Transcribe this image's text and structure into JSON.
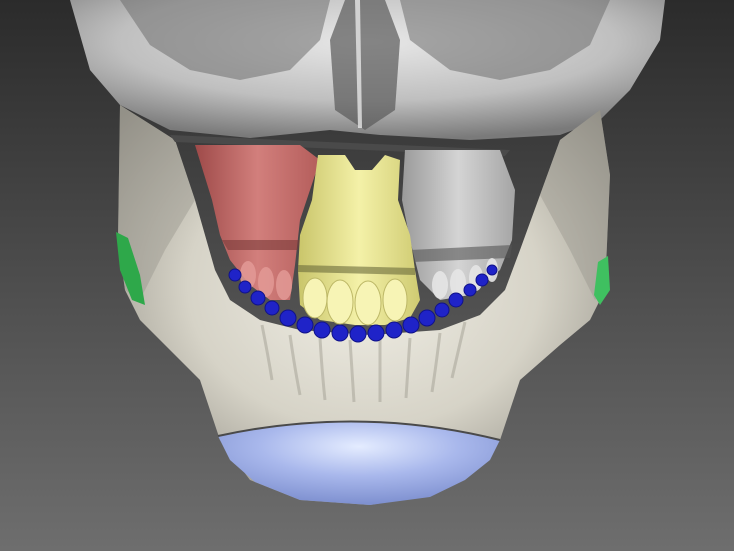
{
  "viewport": {
    "background_top": "#2b2b2b",
    "background_bottom": "#6e6e6e"
  },
  "model": {
    "bone_color": "#d9d7cc",
    "skull_color": "#c9c9c9",
    "segments": [
      {
        "name": "maxilla-left-segment",
        "color": "#c8706e"
      },
      {
        "name": "maxilla-center-segment",
        "color": "#e6e38f"
      },
      {
        "name": "maxilla-right-segment",
        "color": "#bdbdbd"
      },
      {
        "name": "lower-dental-arch",
        "color": "#1f23c8"
      },
      {
        "name": "chin-genioplasty-segment",
        "color": "#a3b3e8"
      },
      {
        "name": "mandibular-angle-left-marker",
        "color": "#2ea84a"
      },
      {
        "name": "mandibular-angle-right-marker",
        "color": "#3fc060"
      }
    ]
  }
}
